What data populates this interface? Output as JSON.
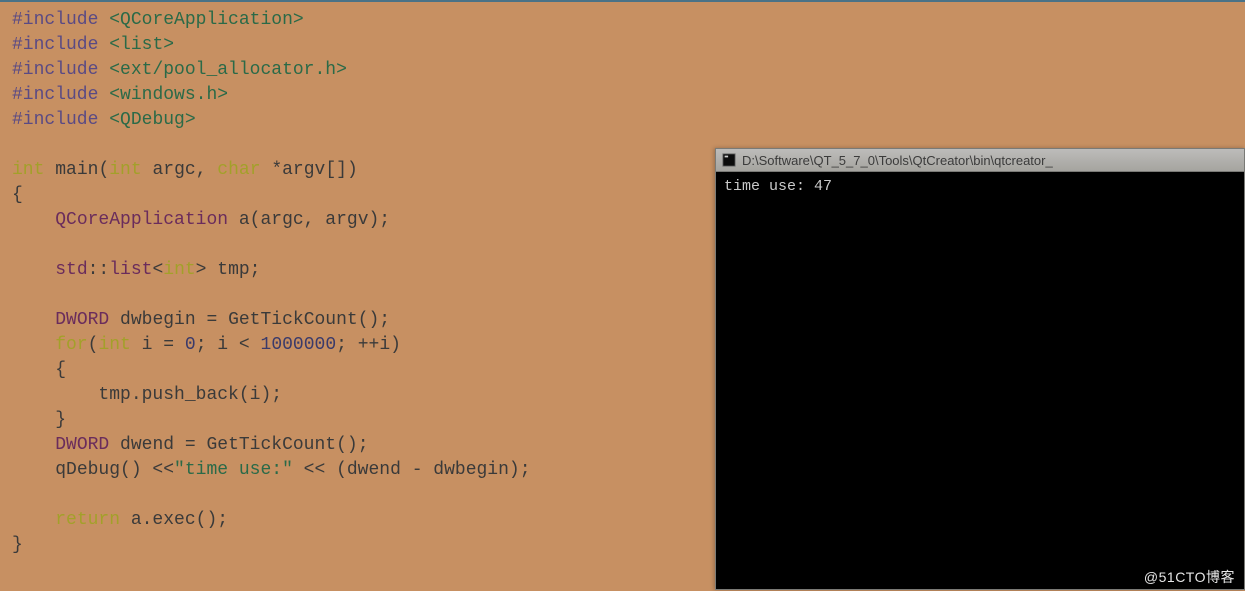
{
  "code": {
    "include1": "#include",
    "inc1": "<QCoreApplication>",
    "inc2": "<list>",
    "inc3": "<ext/pool_allocator.h>",
    "inc4": "<windows.h>",
    "inc5": "<QDebug>",
    "kw_int": "int",
    "kw_char": "char",
    "kw_for": "for",
    "kw_return": "return",
    "id_main": "main",
    "id_argc": "argc",
    "id_argv": "*argv[]",
    "type_qapp": "QCoreApplication",
    "id_a": "a",
    "args_a": "(argc, argv);",
    "type_std": "std",
    "type_list": "list",
    "type_intg": "int",
    "id_tmp": "tmp;",
    "type_dword": "DWORD",
    "id_dwbegin": "dwbegin",
    "eq": " = ",
    "fn_tick": "GetTickCount();",
    "for_open": "(",
    "id_i": "i",
    "zero": "0",
    "semi": "; ",
    "lt": " < ",
    "limit": "1000000",
    "inc_i": "; ++i)",
    "lbrace": "{",
    "rbrace": "}",
    "push": "tmp.push_back(i);",
    "id_dwend": "dwend",
    "qdebug": "qDebug() <<",
    "strlit": "\"time use:\"",
    "tail": " << (dwend - dwbegin);",
    "ret": " a.exec();"
  },
  "console": {
    "title": "D:\\Software\\QT_5_7_0\\Tools\\QtCreator\\bin\\qtcreator_",
    "output": "time use: 47"
  },
  "watermark": "@51CTO博客"
}
